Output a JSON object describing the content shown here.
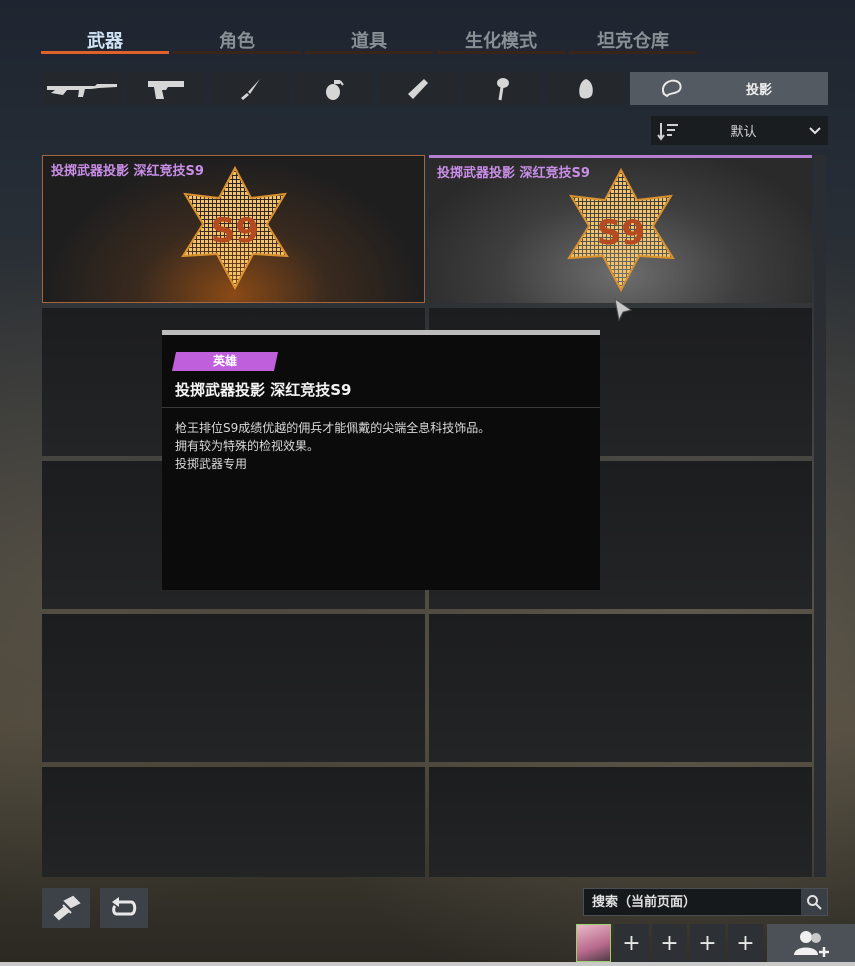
{
  "tabs": [
    {
      "label": "武器",
      "active": true
    },
    {
      "label": "角色",
      "active": false
    },
    {
      "label": "道具",
      "active": false
    },
    {
      "label": "生化模式",
      "active": false
    },
    {
      "label": "坦克仓库",
      "active": false
    }
  ],
  "categories": {
    "icons": [
      "rifle-icon",
      "pistol-icon",
      "knife-icon",
      "grenade-icon",
      "tube-icon",
      "pendant-icon",
      "egg-icon",
      "projection-icon"
    ],
    "active_label": "投影"
  },
  "sort": {
    "label": "默认"
  },
  "items": [
    {
      "title": "投掷武器投影 深红竞技S9",
      "selected": true
    },
    {
      "title": "投掷武器投影 深红竞技S9",
      "selected": false
    }
  ],
  "tooltip": {
    "rarity": "英雄",
    "name": "投掷武器投影 深红竞技S9",
    "desc_line1": "枪王排位S9成绩优越的佣兵才能佩戴的尖端全息科技饰品。",
    "desc_line2": "拥有较为特殊的检视效果。",
    "desc_line3": "投掷武器专用",
    "emblem_text": "S9"
  },
  "search": {
    "placeholder": "搜索（当前页面）"
  },
  "party": {
    "slot_symbol": "+"
  },
  "colors": {
    "accent": "#e0622a",
    "rarity": "#c05fdc",
    "item_title": "#c98ee6"
  }
}
